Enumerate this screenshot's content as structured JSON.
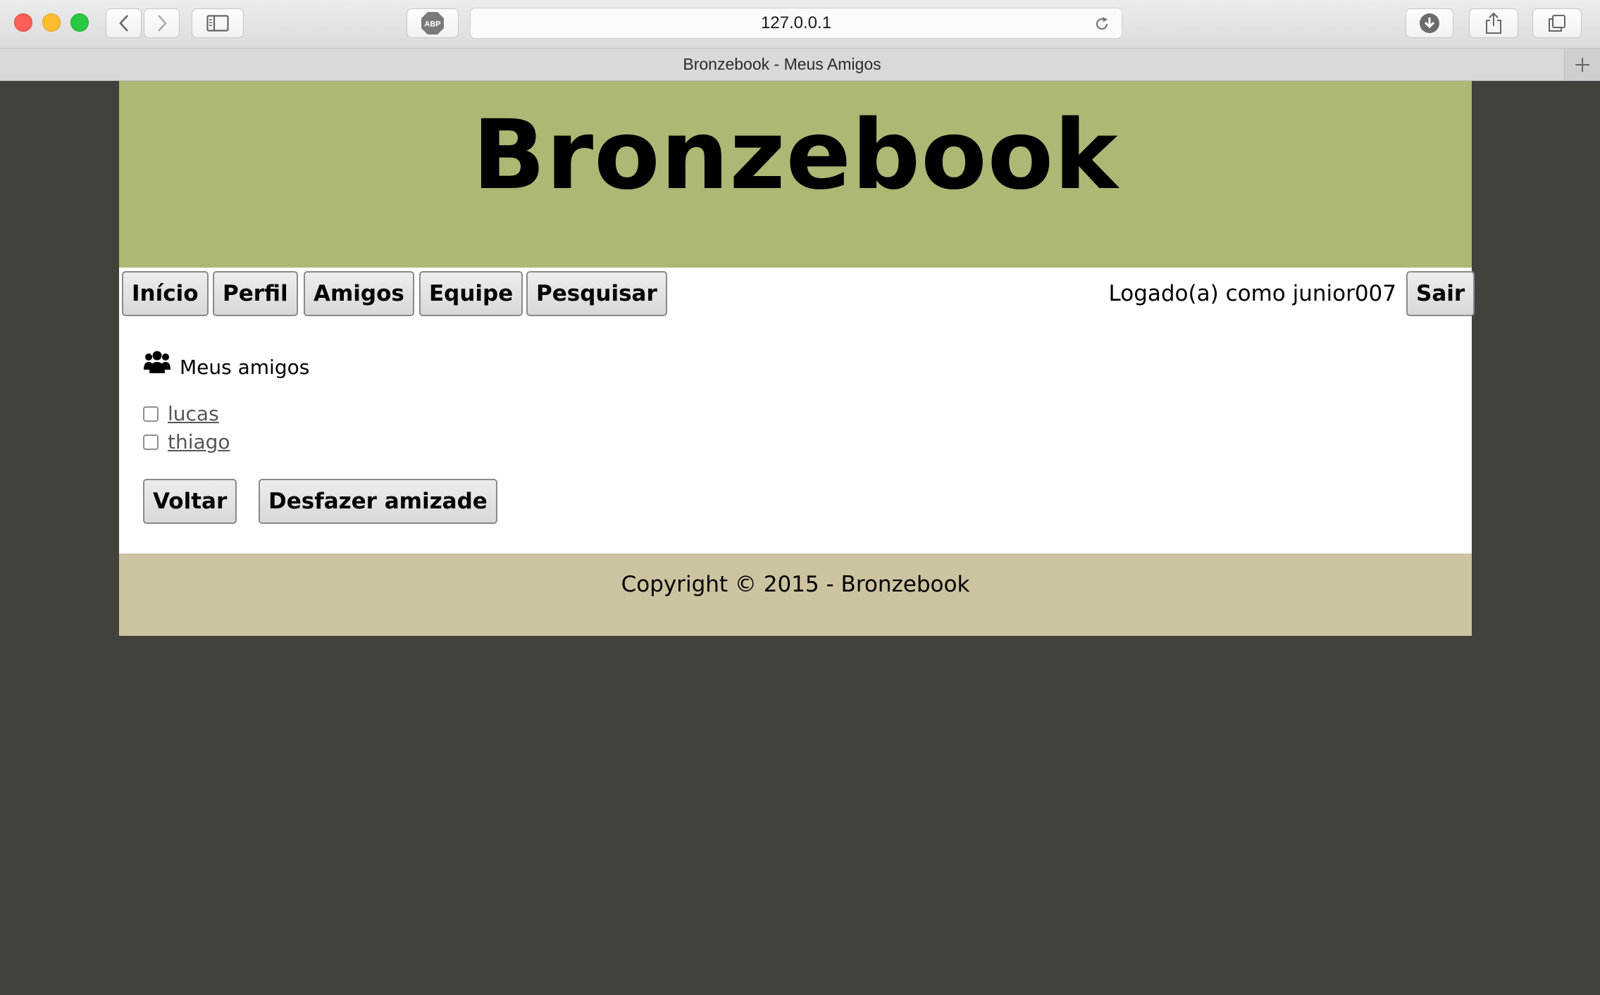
{
  "browser": {
    "url": "127.0.0.1",
    "tab_title": "Bronzebook - Meus Amigos",
    "adblock_label": "ABP"
  },
  "site": {
    "title": "Bronzebook"
  },
  "nav": {
    "items": [
      {
        "label": "Início"
      },
      {
        "label": "Perfil"
      },
      {
        "label": "Amigos"
      },
      {
        "label": "Equipe"
      },
      {
        "label": "Pesquisar"
      }
    ],
    "logged_in_text": "Logado(a) como junior007",
    "logout_label": "Sair"
  },
  "friends": {
    "section_title": "Meus amigos",
    "section_icon": "users-icon",
    "list": [
      {
        "name": "lucas",
        "checked": false
      },
      {
        "name": "thiago",
        "checked": false
      }
    ],
    "back_label": "Voltar",
    "unfriend_label": "Desfazer amizade"
  },
  "footer": {
    "copyright": "Copyright © 2015 - Bronzebook"
  },
  "colors": {
    "header_bg": "#acb874",
    "footer_bg": "#ccc4a0",
    "page_bg": "#42413c"
  }
}
